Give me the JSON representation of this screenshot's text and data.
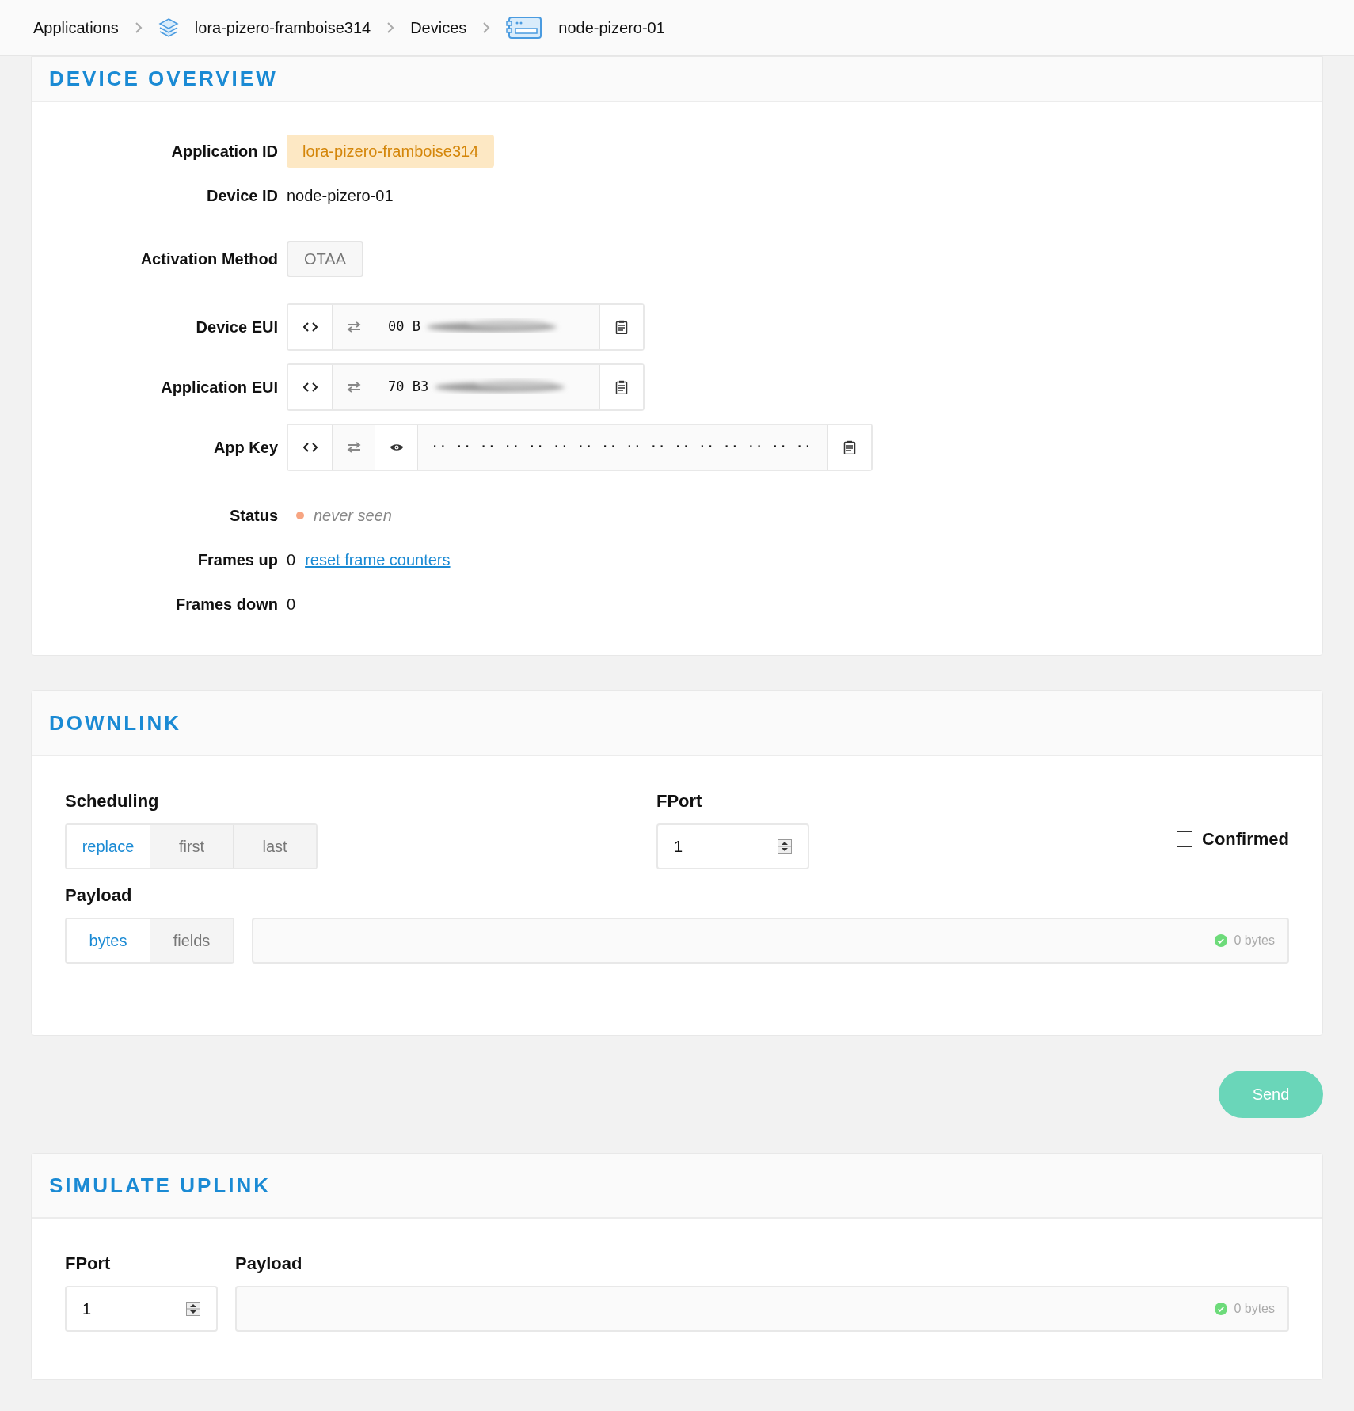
{
  "breadcrumb": [
    {
      "kind": "text",
      "label": "Applications"
    },
    {
      "kind": "app",
      "label": "lora-pizero-framboise314"
    },
    {
      "kind": "text",
      "label": "Devices"
    },
    {
      "kind": "device",
      "label": "node-pizero-01"
    }
  ],
  "overview": {
    "title": "DEVICE OVERVIEW",
    "groups": [
      [
        {
          "kind": "highlight",
          "label": "Application ID",
          "value": "lora-pizero-framboise314"
        },
        {
          "kind": "plain",
          "label": "Device ID",
          "value": "node-pizero-01"
        }
      ],
      [
        {
          "kind": "tag",
          "label": "Activation Method",
          "value": "OTAA"
        }
      ],
      [
        {
          "kind": "eui",
          "label": "Device EUI",
          "value": "00 B"
        },
        {
          "kind": "eui",
          "label": "Application EUI",
          "value": "70 B3"
        },
        {
          "kind": "key",
          "label": "App Key",
          "value": "·· ·· ·· ·· ·· ·· ·· ·· ·· ·· ·· ·· ·· ·· ·· ··"
        }
      ],
      [
        {
          "kind": "status",
          "label": "Status",
          "value": "never seen",
          "color": "#f7a582"
        },
        {
          "kind": "counter",
          "label": "Frames up",
          "value": "0",
          "link": "reset frame counters"
        },
        {
          "kind": "plain",
          "label": "Frames down",
          "value": "0"
        }
      ]
    ]
  },
  "downlink": {
    "title": "DOWNLINK",
    "scheduling_label": "Scheduling",
    "scheduling": [
      {
        "label": "replace",
        "selected": true
      },
      {
        "label": "first",
        "selected": false
      },
      {
        "label": "last",
        "selected": false
      }
    ],
    "fport_label": "FPort",
    "fport": "1",
    "confirmed": {
      "label": "Confirmed",
      "checked": false
    },
    "payload_label": "Payload",
    "formats": [
      {
        "label": "bytes",
        "selected": true
      },
      {
        "label": "fields",
        "selected": false
      }
    ],
    "byte_count": "0 bytes",
    "send": "Send"
  },
  "uplink": {
    "title": "SIMULATE UPLINK",
    "fport_label": "FPort",
    "fport": "1",
    "payload_label": "Payload",
    "byte_count": "0 bytes"
  }
}
